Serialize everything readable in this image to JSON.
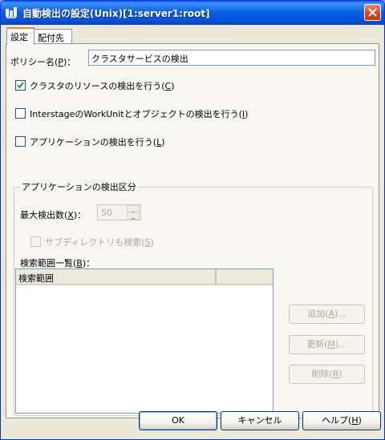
{
  "window": {
    "title": "自動検出の設定(Unix)[1:server1:root]"
  },
  "tabs": [
    {
      "label": "設定"
    },
    {
      "label": "配付先"
    }
  ],
  "policy": {
    "label_prefix": "ポリシー名(",
    "label_key": "P",
    "label_suffix": ")：",
    "value": "クラスタサービスの検出"
  },
  "checkboxes": {
    "cluster": {
      "text": "クラスタのリソースの検出を行う(",
      "key": "C",
      "suffix": ")",
      "checked": true
    },
    "interstage": {
      "text": "InterstageのWorkUnitとオブジェクトの検出を行う(",
      "key": "I",
      "suffix": ")",
      "checked": false
    },
    "application": {
      "text": "アプリケーションの検出を行う(",
      "key": "L",
      "suffix": ")",
      "checked": false
    }
  },
  "group": {
    "title": "アプリケーションの検出区分",
    "max_label": "最大検出数(",
    "max_key": "X",
    "max_suffix": ")：",
    "max_value": "50",
    "subdir": {
      "text": "サブディレクトリも検索(",
      "key": "S",
      "suffix": ")",
      "checked": false
    },
    "range_label": "検索範囲一覧(",
    "range_key": "B",
    "range_suffix": ")：",
    "column_header": "検索範囲",
    "buttons": {
      "add": {
        "text": "追加(",
        "key": "A",
        "suffix": ")..."
      },
      "update": {
        "text": "更新(",
        "key": "M",
        "suffix": ")..."
      },
      "delete": {
        "text": "削除(",
        "key": "R",
        "suffix": ")"
      }
    }
  },
  "footer": {
    "ok": "OK",
    "cancel": "キャンセル",
    "help": {
      "text": "ヘルプ(",
      "key": "H",
      "suffix": ")"
    }
  }
}
